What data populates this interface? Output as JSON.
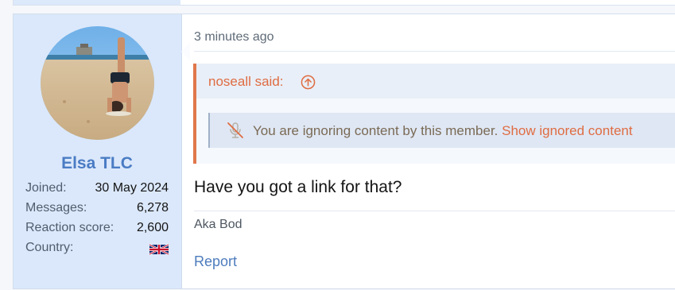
{
  "post": {
    "user": {
      "name": "Elsa TLC",
      "stats": [
        {
          "label": "Joined:",
          "value": "30 May 2024"
        },
        {
          "label": "Messages:",
          "value": "6,278"
        },
        {
          "label": "Reaction score:",
          "value": "2,600"
        },
        {
          "label": "Country:",
          "value": "",
          "icon": "uk-flag-icon"
        }
      ]
    },
    "date": "3 minutes ago",
    "quote": {
      "author": "noseall said:",
      "ignored_text": "You are ignoring content by this member.",
      "show_link": "Show ignored content"
    },
    "message": "Have you got a link for that?",
    "signature": "Aka Bod",
    "report_label": "Report"
  },
  "colors": {
    "accent": "#df6c42",
    "username": "#4a7cc4",
    "user_panel": "#dbe8fb",
    "link": "#4d7cbd"
  }
}
